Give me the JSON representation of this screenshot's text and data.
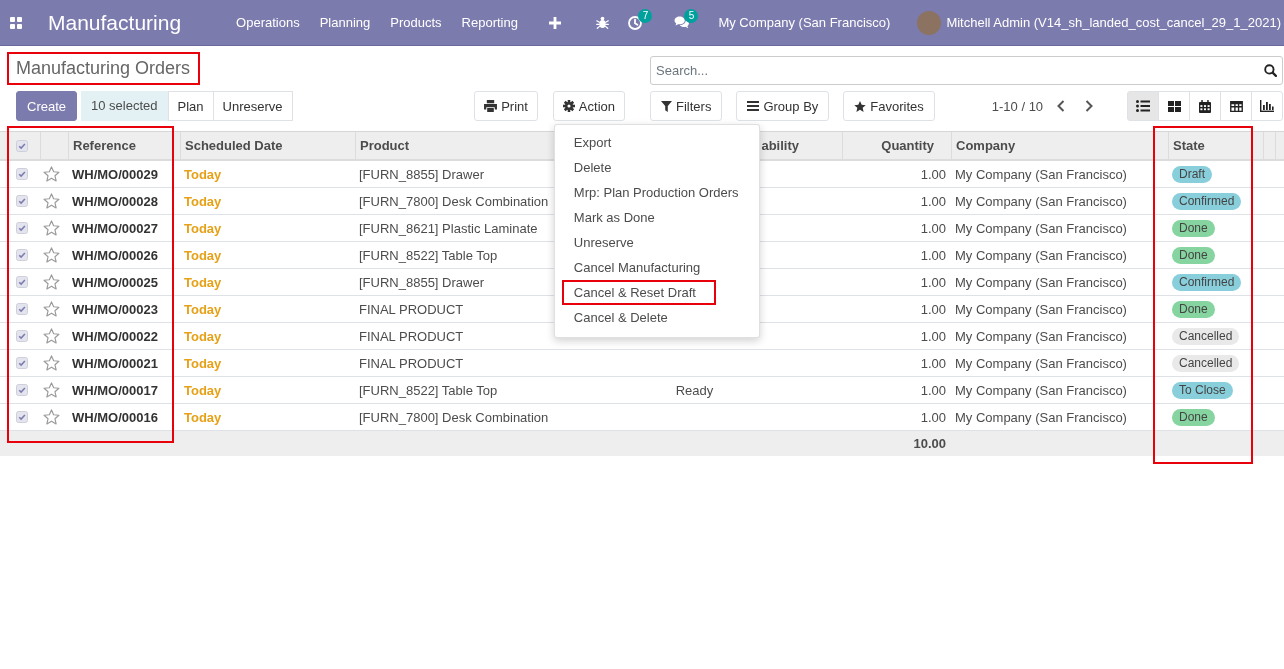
{
  "navbar": {
    "app_name": "Manufacturing",
    "menu": [
      "Operations",
      "Planning",
      "Products",
      "Reporting"
    ],
    "activity_count": "7",
    "message_count": "5",
    "company": "My Company (San Francisco)",
    "user": "Mitchell Admin (V14_sh_landed_cost_cancel_29_1_2021)"
  },
  "breadcrumb": {
    "title": "Manufacturing Orders",
    "highlighted": true
  },
  "search": {
    "placeholder": "Search..."
  },
  "toolbar": {
    "create": "Create",
    "selection": "10 selected",
    "actions": [
      "Plan",
      "Unreserve"
    ],
    "print": "Print",
    "action_menu": {
      "label": "Action",
      "expanded": true,
      "items": [
        {
          "label": "Export",
          "highlighted": false
        },
        {
          "label": "Delete",
          "highlighted": false
        },
        {
          "label": "Mrp: Plan Production Orders",
          "highlighted": false
        },
        {
          "label": "Mark as Done",
          "highlighted": false
        },
        {
          "label": "Unreserve",
          "highlighted": false
        },
        {
          "label": "Cancel Manufacturing",
          "highlighted": false
        },
        {
          "label": "Cancel & Reset Draft",
          "highlighted": true
        },
        {
          "label": "Cancel & Delete",
          "highlighted": false
        }
      ]
    }
  },
  "search_buttons": [
    {
      "kind": "filters",
      "label": "Filters"
    },
    {
      "kind": "group_by",
      "label": "Group By"
    },
    {
      "kind": "favorites",
      "label": "Favorites"
    }
  ],
  "pager": "1-10 / 10",
  "views": [
    {
      "kind": "list",
      "selected": true
    },
    {
      "kind": "kanban",
      "selected": false
    },
    {
      "kind": "calendar",
      "selected": false
    },
    {
      "kind": "pivot",
      "selected": false
    },
    {
      "kind": "graph",
      "selected": false
    }
  ],
  "table": {
    "select_all": true,
    "columns": [
      {
        "label": "Reference",
        "highlighted": true
      },
      {
        "label": "Scheduled Date",
        "highlighted": false
      },
      {
        "label": "Product",
        "highlighted": false
      },
      {
        "label": "ability",
        "highlighted": false
      },
      {
        "label": "Quantity",
        "highlighted": false
      },
      {
        "label": "Company",
        "highlighted": false
      },
      {
        "label": "State",
        "highlighted": true
      }
    ],
    "rows": [
      {
        "checked": true,
        "starred": false,
        "reference": "WH/MO/00029",
        "scheduled_date": "Today",
        "product": "[FURN_8855] Drawer",
        "quantity": "1.00",
        "company": "My Company (San Francisco)",
        "state": {
          "label": "Draft",
          "color": "#88cfdb"
        }
      },
      {
        "checked": true,
        "starred": false,
        "reference": "WH/MO/00028",
        "scheduled_date": "Today",
        "product": "[FURN_7800] Desk Combination",
        "quantity": "1.00",
        "company": "My Company (San Francisco)",
        "state": {
          "label": "Confirmed",
          "color": "#88cfdb"
        }
      },
      {
        "checked": true,
        "starred": false,
        "reference": "WH/MO/00027",
        "scheduled_date": "Today",
        "product": "[FURN_8621] Plastic Laminate",
        "quantity": "1.00",
        "company": "My Company (San Francisco)",
        "state": {
          "label": "Done",
          "color": "#86d4a0"
        }
      },
      {
        "checked": true,
        "starred": false,
        "reference": "WH/MO/00026",
        "scheduled_date": "Today",
        "product": "[FURN_8522] Table Top",
        "quantity": "1.00",
        "company": "My Company (San Francisco)",
        "state": {
          "label": "Done",
          "color": "#86d4a0"
        }
      },
      {
        "checked": true,
        "starred": false,
        "reference": "WH/MO/00025",
        "scheduled_date": "Today",
        "product": "[FURN_8855] Drawer",
        "quantity": "1.00",
        "company": "My Company (San Francisco)",
        "state": {
          "label": "Confirmed",
          "color": "#88cfdb"
        }
      },
      {
        "checked": true,
        "starred": false,
        "reference": "WH/MO/00023",
        "scheduled_date": "Today",
        "product": "FINAL PRODUCT",
        "quantity": "1.00",
        "company": "My Company (San Francisco)",
        "state": {
          "label": "Done",
          "color": "#86d4a0"
        }
      },
      {
        "checked": true,
        "starred": false,
        "reference": "WH/MO/00022",
        "scheduled_date": "Today",
        "product": "FINAL PRODUCT",
        "quantity": "1.00",
        "company": "My Company (San Francisco)",
        "state": {
          "label": "Cancelled",
          "color": "#e9e9e9"
        }
      },
      {
        "checked": true,
        "starred": false,
        "reference": "WH/MO/00021",
        "scheduled_date": "Today",
        "product": "FINAL PRODUCT",
        "quantity": "1.00",
        "company": "My Company (San Francisco)",
        "state": {
          "label": "Cancelled",
          "color": "#e9e9e9"
        }
      },
      {
        "checked": true,
        "starred": false,
        "reference": "WH/MO/00017",
        "scheduled_date": "Today",
        "product": "[FURN_8522] Table Top",
        "column_4": "Ready",
        "quantity": "1.00",
        "company": "My Company (San Francisco)",
        "state": {
          "label": "To Close",
          "color": "#88cfdb"
        }
      },
      {
        "checked": true,
        "starred": false,
        "reference": "WH/MO/00016",
        "scheduled_date": "Today",
        "product": "[FURN_7800] Desk Combination",
        "quantity": "1.00",
        "company": "My Company (San Francisco)",
        "state": {
          "label": "Done",
          "color": "#86d4a0"
        }
      }
    ],
    "total_quantity": "10.00"
  }
}
